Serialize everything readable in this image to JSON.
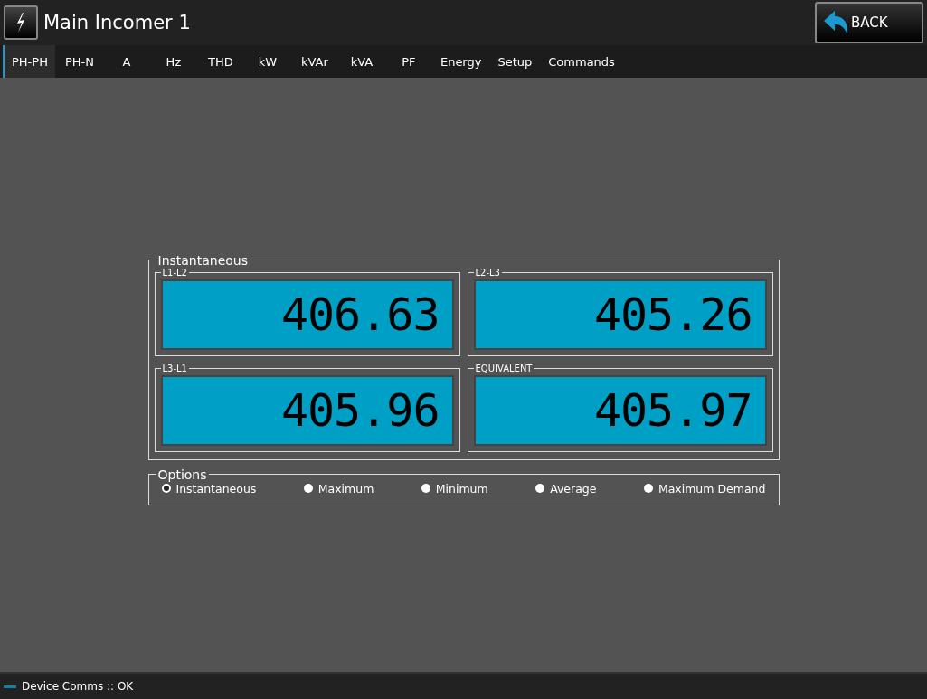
{
  "window": {
    "title": "Main Incomer 1"
  },
  "back_button": {
    "label": "BACK"
  },
  "tabs": [
    {
      "label": "PH-PH",
      "selected": true
    },
    {
      "label": "PH-N",
      "selected": false
    },
    {
      "label": "A",
      "selected": false
    },
    {
      "label": "Hz",
      "selected": false
    },
    {
      "label": "THD",
      "selected": false
    },
    {
      "label": "kW",
      "selected": false
    },
    {
      "label": "kVAr",
      "selected": false
    },
    {
      "label": "kVA",
      "selected": false
    },
    {
      "label": "PF",
      "selected": false
    },
    {
      "label": "Energy",
      "selected": false
    },
    {
      "label": "Setup",
      "selected": false
    },
    {
      "label": "Commands",
      "selected": false
    }
  ],
  "readings": {
    "title": "Instantaneous",
    "meters": [
      {
        "label": "L1-L2",
        "value": "406.63"
      },
      {
        "label": "L2-L3",
        "value": "405.26"
      },
      {
        "label": "L3-L1",
        "value": "405.96"
      },
      {
        "label": "EQUIVALENT",
        "value": "405.97"
      }
    ]
  },
  "options": {
    "title": "Options",
    "items": [
      {
        "label": "Instantaneous",
        "selected": true
      },
      {
        "label": "Maximum",
        "selected": false
      },
      {
        "label": "Minimum",
        "selected": false
      },
      {
        "label": "Average",
        "selected": false
      },
      {
        "label": "Maximum Demand",
        "selected": false
      }
    ]
  },
  "status_bar": {
    "text": "Device Comms :: OK"
  }
}
